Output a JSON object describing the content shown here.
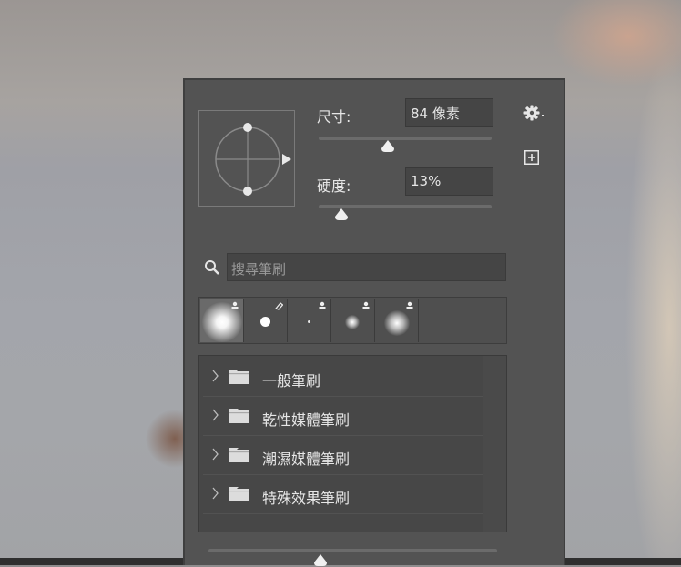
{
  "brush_panel": {
    "size_label": "尺寸:",
    "size_value": "84 像素",
    "size_slider": 0.4,
    "hardness_label": "硬度:",
    "hardness_value": "13%",
    "hardness_slider": 0.13,
    "search_placeholder": "搜尋筆刷",
    "folders": [
      {
        "name": "一般筆刷"
      },
      {
        "name": "乾性媒體筆刷"
      },
      {
        "name": "潮濕媒體筆刷"
      },
      {
        "name": "特殊效果筆刷"
      }
    ]
  },
  "icons": {
    "gear": "gear-icon",
    "add": "add-preset-icon",
    "search": "search-icon",
    "folder": "folder-icon",
    "chevron": "chevron-right-icon"
  },
  "colors": {
    "panel_bg": "#535353",
    "field_bg": "#454545",
    "text": "#e6e6e6"
  }
}
